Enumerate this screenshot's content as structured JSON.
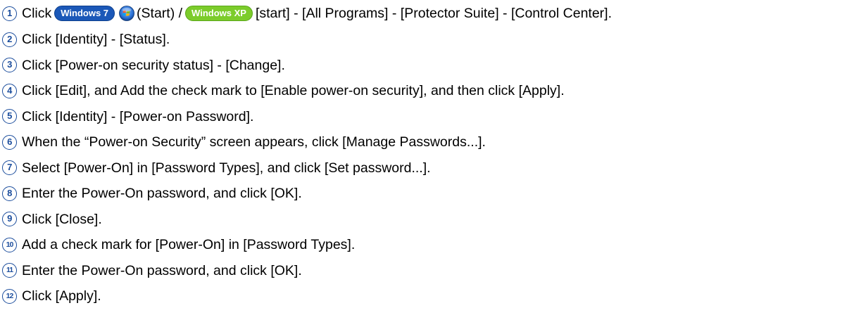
{
  "steps": [
    {
      "num": "1",
      "parts": {
        "pre": "Click",
        "win7_badge": "Windows 7",
        "start_label": "(Start) /",
        "winxp_badge": "Windows XP",
        "post": "[start] - [All Programs] - [Protector Suite] - [Control Center]."
      }
    },
    {
      "num": "2",
      "text": "Click [Identity] - [Status]."
    },
    {
      "num": "3",
      "text": "Click [Power-on security status] - [Change]."
    },
    {
      "num": "4",
      "text": "Click [Edit], and Add the check mark to [Enable power-on security], and then click [Apply]."
    },
    {
      "num": "5",
      "text": "Click [Identity] - [Power-on Password]."
    },
    {
      "num": "6",
      "text": "When the “Power-on Security” screen appears, click [Manage Passwords...]."
    },
    {
      "num": "7",
      "text": "Select [Power-On] in [Password Types], and click [Set password...]."
    },
    {
      "num": "8",
      "text": "Enter the Power-On password, and click [OK]."
    },
    {
      "num": "9",
      "text": "Click [Close]."
    },
    {
      "num": "10",
      "text": "Add a check mark for [Power-On] in [Password Types]."
    },
    {
      "num": "11",
      "text": "Enter the Power-On password, and click [OK]."
    },
    {
      "num": "12",
      "text": "Click [Apply]."
    }
  ],
  "icons": {
    "start_orb": "windows-start-orb-icon"
  },
  "colors": {
    "step_number": "#1a4c9c",
    "win7_badge": "#1b58b8",
    "winxp_badge": "#7ccc2b",
    "text": "#000000"
  }
}
